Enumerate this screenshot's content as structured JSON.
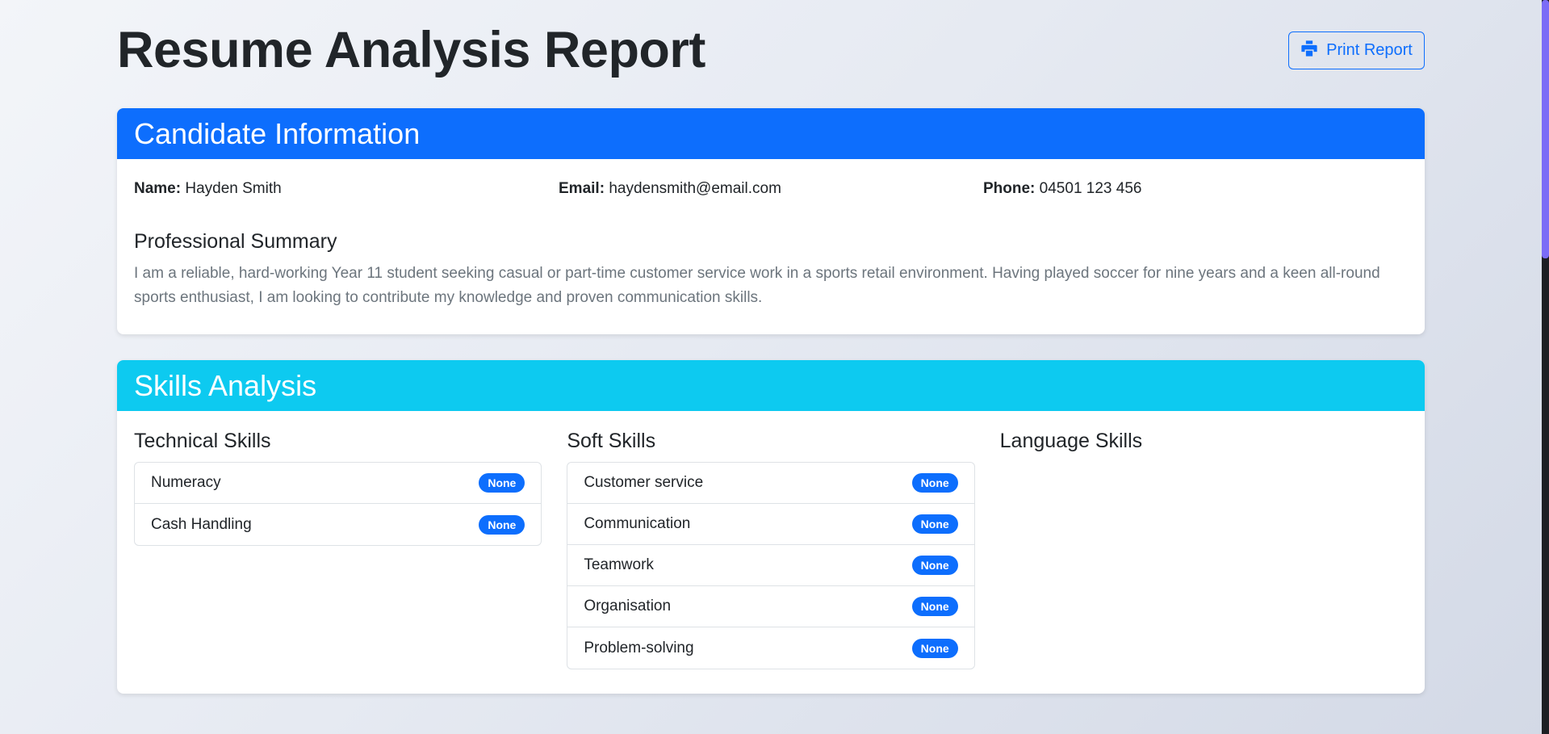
{
  "header": {
    "title": "Resume Analysis Report",
    "print_label": "Print Report"
  },
  "candidate": {
    "section_title": "Candidate Information",
    "name_label": "Name:",
    "name": "Hayden Smith",
    "email_label": "Email:",
    "email": "haydensmith@email.com",
    "phone_label": "Phone:",
    "phone": "04501 123 456",
    "summary_title": "Professional Summary",
    "summary": "I am a reliable, hard-working Year 11 student seeking casual or part-time customer service work in a sports retail environment. Having played soccer for nine years and a keen all-round sports enthusiast, I am looking to contribute my knowledge and proven communication skills."
  },
  "skills": {
    "section_title": "Skills Analysis",
    "technical": {
      "title": "Technical Skills",
      "items": [
        {
          "label": "Numeracy",
          "badge": "None"
        },
        {
          "label": "Cash Handling",
          "badge": "None"
        }
      ]
    },
    "soft": {
      "title": "Soft Skills",
      "items": [
        {
          "label": "Customer service",
          "badge": "None"
        },
        {
          "label": "Communication",
          "badge": "None"
        },
        {
          "label": "Teamwork",
          "badge": "None"
        },
        {
          "label": "Organisation",
          "badge": "None"
        },
        {
          "label": "Problem-solving",
          "badge": "None"
        }
      ]
    },
    "language": {
      "title": "Language Skills",
      "items": []
    }
  },
  "colors": {
    "primary": "#0d6efd",
    "info": "#0dcaf0"
  }
}
